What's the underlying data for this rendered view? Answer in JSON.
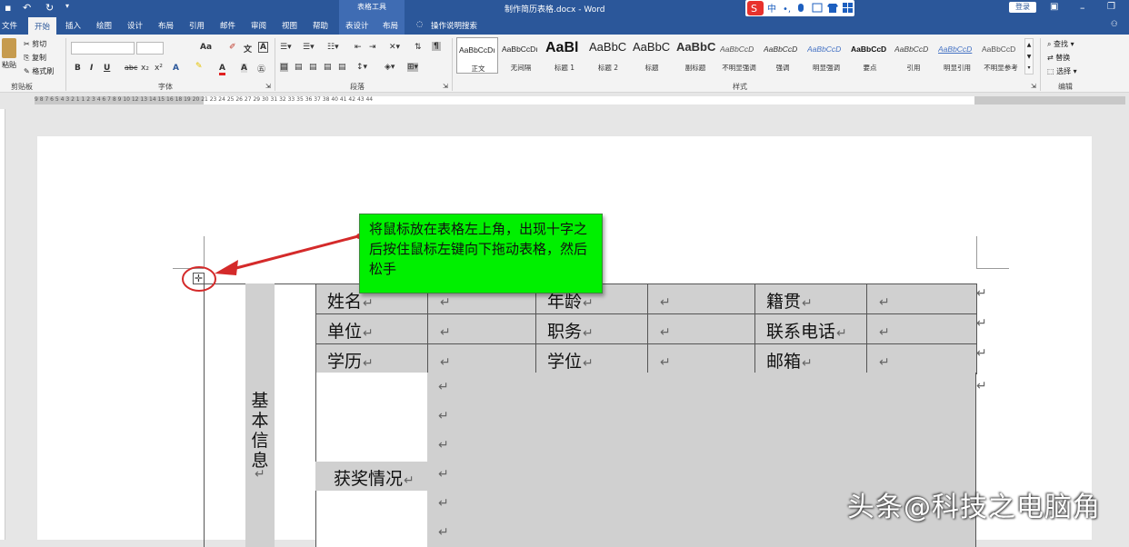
{
  "titlebar": {
    "context_tool": "表格工具",
    "doc_title": "制作简历表格.docx  -  Word",
    "login": "登录",
    "colors": {
      "bar": "#2b579a"
    }
  },
  "tabs": [
    "文件",
    "开始",
    "插入",
    "绘图",
    "设计",
    "布局",
    "引用",
    "邮件",
    "审阅",
    "视图",
    "帮助",
    "表设计",
    "布局"
  ],
  "tell_me": "操作说明搜索",
  "ribbon": {
    "clipboard": {
      "paste": "粘贴",
      "cut": "剪切",
      "copy": "复制",
      "format_painter": "格式刷",
      "label": "剪贴板"
    },
    "font": {
      "size_glyph": "Aa",
      "bold": "B",
      "italic": "I",
      "underline": "U",
      "strike": "abc",
      "sub": "x₂",
      "sup": "x²",
      "label": "字体"
    },
    "paragraph": {
      "label": "段落"
    },
    "styles": {
      "label": "样式",
      "items": [
        {
          "sample": "AaBbCcDı",
          "name": "正文"
        },
        {
          "sample": "AaBbCcDı",
          "name": "无间隔"
        },
        {
          "sample": "AaBl",
          "name": "标题 1"
        },
        {
          "sample": "AaBbC",
          "name": "标题 2"
        },
        {
          "sample": "AaBbC",
          "name": "标题"
        },
        {
          "sample": "AaBbC",
          "name": "副标题"
        },
        {
          "sample": "AaBbCcD",
          "name": "不明显强调"
        },
        {
          "sample": "AaBbCcD",
          "name": "强调"
        },
        {
          "sample": "AaBbCcD",
          "name": "明显强调"
        },
        {
          "sample": "AaBbCcD",
          "name": "要点"
        },
        {
          "sample": "AaBbCcD",
          "name": "引用"
        },
        {
          "sample": "AaBbCcD",
          "name": "明显引用"
        },
        {
          "sample": "AaBbCcD",
          "name": "不明显参考"
        }
      ]
    },
    "editing": {
      "find": "查找",
      "replace": "替换",
      "select": "选择",
      "label": "编辑"
    }
  },
  "ruler_text": "9 8 7 6 5 4 3 2 1   1 2 3 4   6 7 8 9 10   12 13 14 15 16   18 19 20 21   23 24 25 26 27   29 30 31 32 33   35 36 37 38   40 41 42 43 44",
  "table": {
    "rows": [
      [
        {
          "t": "姓名"
        },
        {
          "t": ""
        },
        {
          "t": "年龄"
        },
        {
          "t": ""
        },
        {
          "t": "籍贯"
        },
        {
          "t": ""
        }
      ],
      [
        {
          "t": "单位"
        },
        {
          "t": ""
        },
        {
          "t": "职务"
        },
        {
          "t": ""
        },
        {
          "t": "联系电话"
        },
        {
          "t": ""
        }
      ],
      [
        {
          "t": "学历"
        },
        {
          "t": ""
        },
        {
          "t": "学位"
        },
        {
          "t": ""
        },
        {
          "t": "邮箱"
        },
        {
          "t": ""
        }
      ]
    ],
    "side_header": "基本信息",
    "award_label": "获奖情况",
    "para_mark": "↵"
  },
  "callout": "将鼠标放在表格左上角，出现十字之后按住鼠标左键向下拖动表格，然后松手",
  "watermark": "头条@科技之电脑角"
}
